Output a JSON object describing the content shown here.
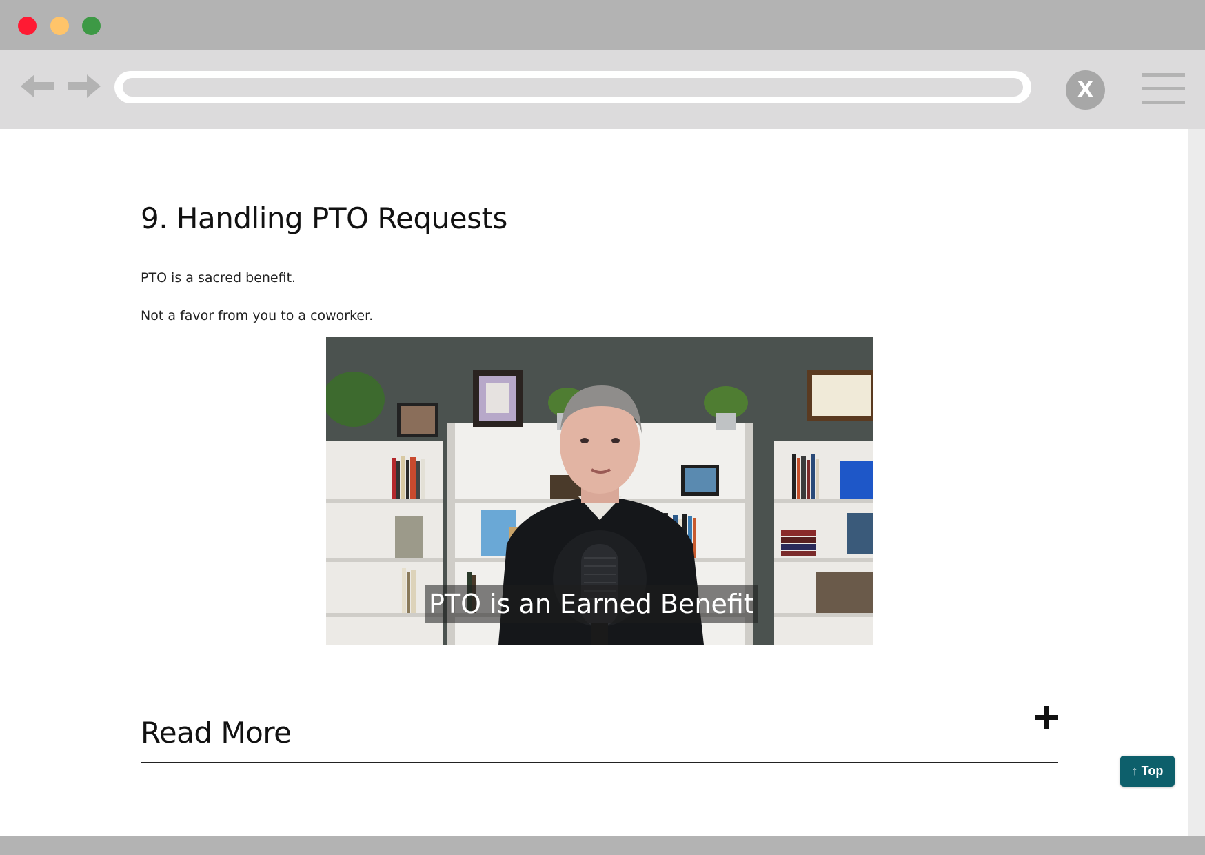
{
  "browser": {
    "window_controls": [
      "close-dot",
      "minimize-dot",
      "maximize-dot"
    ],
    "close_label": "X",
    "url": ""
  },
  "article": {
    "heading": "9. Handling PTO Requests",
    "paragraphs": [
      "PTO is a sacred benefit.",
      "Not a favor from you to a coworker."
    ],
    "video": {
      "caption": "PTO is an Earned Benefit"
    },
    "accordion": {
      "label": "Read More"
    }
  },
  "back_to_top": {
    "label": "↑ Top",
    "color": "#0d5f6b"
  },
  "colors": {
    "titlebar": "#b3b3b3",
    "toolbar": "#dcdbdc",
    "close_red": "#ff1a33",
    "minimize_yellow": "#ffc46a",
    "maximize_green": "#3d9945"
  }
}
